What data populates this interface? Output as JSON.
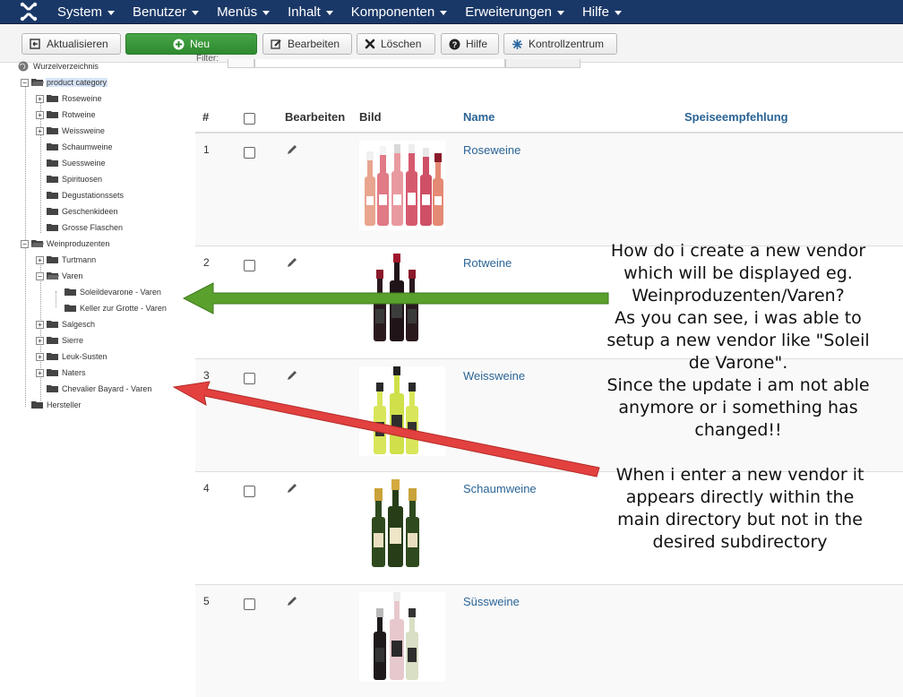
{
  "nav": {
    "menu": [
      "System",
      "Benutzer",
      "Menüs",
      "Inhalt",
      "Komponenten",
      "Erweiterungen",
      "Hilfe"
    ]
  },
  "toolbar": {
    "refresh_label": "Aktualisieren",
    "new_label": "Neu",
    "edit_label": "Bearbeiten",
    "delete_label": "Löschen",
    "help_label": "Hilfe",
    "control_center_label": "Kontrollzentrum"
  },
  "filter": {
    "label": "Filter:"
  },
  "tree": {
    "root": "Wurzelverzeichnis",
    "product_category": "product category",
    "roseweine": "Roseweine",
    "rotweine": "Rotweine",
    "weissweine": "Weissweine",
    "schaumweine": "Schaumweine",
    "suessweine": "Suessweine",
    "spirituosen": "Spirituosen",
    "degustationssets": "Degustationssets",
    "geschenkideen": "Geschenkideen",
    "grosse_flaschen": "Grosse Flaschen",
    "weinproduzenten": "Weinproduzenten",
    "turtmann": "Turtmann",
    "varen": "Varen",
    "soleildevarone": "Soleildevarone - Varen",
    "keller": "Keller zur Grotte - Varen",
    "salgesch": "Salgesch",
    "sierre": "Sierre",
    "leuk": "Leuk-Susten",
    "naters": "Naters",
    "chevalier": "Chevalier Bayard - Varen",
    "hersteller": "Hersteller"
  },
  "table": {
    "headers": {
      "num": "#",
      "edit": "Bearbeiten",
      "image": "Bild",
      "name": "Name",
      "recommendation": "Speiseempfehlung"
    },
    "rows": [
      {
        "num": "1",
        "name": "Roseweine"
      },
      {
        "num": "2",
        "name": "Rotweine"
      },
      {
        "num": "3",
        "name": "Weissweine"
      },
      {
        "num": "4",
        "name": "Schaumweine"
      },
      {
        "num": "5",
        "name": "Süssweine"
      }
    ]
  },
  "annotations": {
    "note1": [
      "How do i create a new vendor",
      "which will be displayed eg.",
      "Weinproduzenten/Varen?",
      "As you can see, i was able to",
      "setup a new vendor like \"Soleil",
      "de Varone\".",
      "Since the update i am not able",
      "anymore or i something has",
      "changed!!"
    ],
    "note2": [
      "When i enter a new vendor it",
      "appears directly within the",
      "main directory but not in the",
      "desired subdirectory"
    ],
    "green_arrow_color": "#5aa02c",
    "red_arrow_color": "#e2413f"
  }
}
